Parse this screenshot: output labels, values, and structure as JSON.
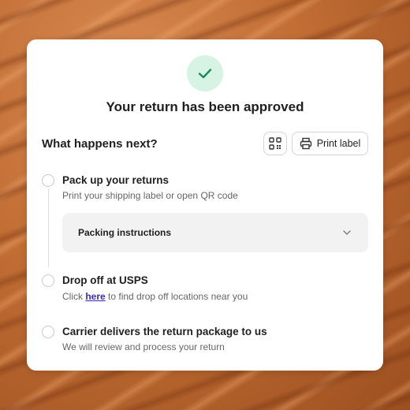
{
  "card": {
    "title": "Your return has been approved",
    "subhead": "What happens next?",
    "print_label": "Print label",
    "icons": {
      "status": "check-icon",
      "qr": "qr-code-icon",
      "print": "printer-icon",
      "accordion": "chevron-down-icon"
    }
  },
  "steps": [
    {
      "title": "Pack up your returns",
      "desc": "Print your shipping label or open QR code"
    },
    {
      "title": "Drop off at USPS",
      "desc_prefix": "Click ",
      "link": "here",
      "desc_suffix": " to find drop off locations near you"
    },
    {
      "title": "Carrier delivers the return package to us",
      "desc": "We will review and process your return"
    }
  ],
  "accordion": {
    "label": "Packing instructions"
  },
  "colors": {
    "check_bg": "#d6f3e3",
    "check_stroke": "#1f8a57",
    "link": "#3a2bb8"
  }
}
